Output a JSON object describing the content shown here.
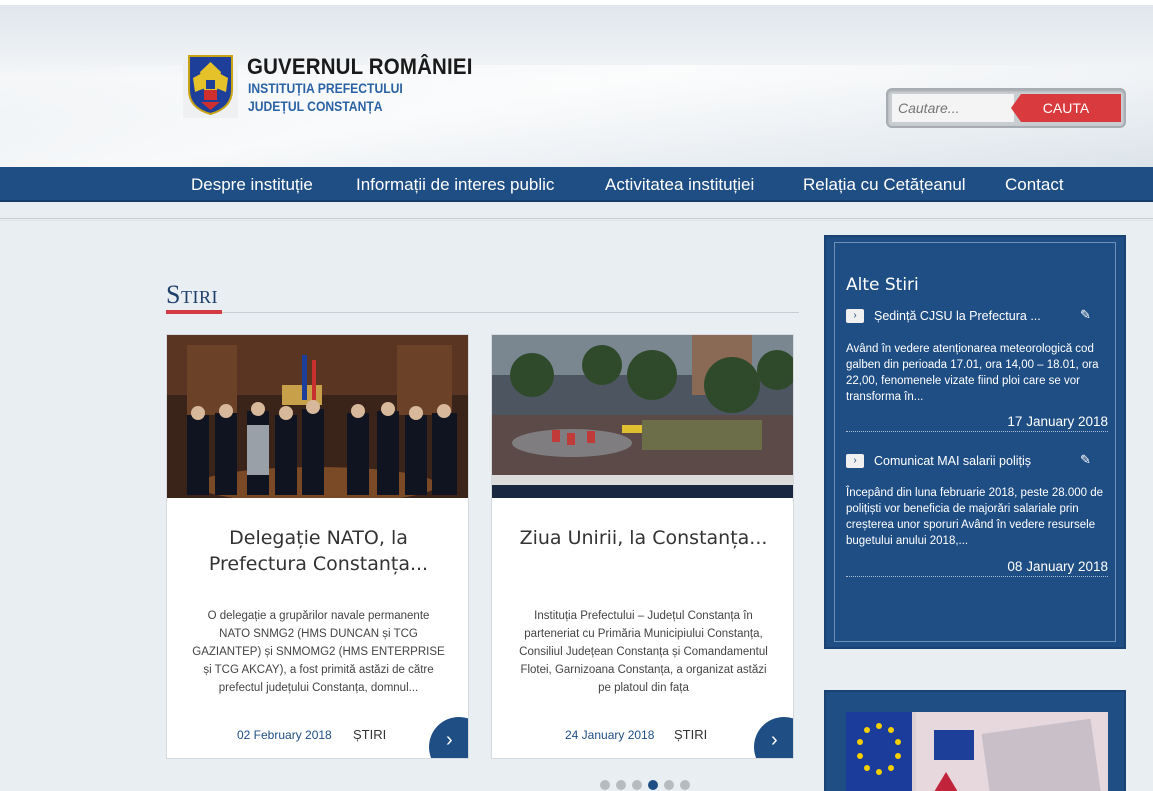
{
  "header": {
    "logo_title": "GUVERNUL ROMÂNIEI",
    "logo_sub1": "INSTITUȚIA PREFECTULUI",
    "logo_sub2": "JUDEȚUL CONSTANȚA",
    "search_placeholder": "Cautare...",
    "search_button": "CAUTA"
  },
  "nav": {
    "items": [
      {
        "label": "Despre instituție"
      },
      {
        "label": "Informații de interes public"
      },
      {
        "label": "Activitatea instituției"
      },
      {
        "label": "Relația cu Cetățeanul"
      },
      {
        "label": "Contact"
      }
    ]
  },
  "main": {
    "section_title": "Stiri",
    "cards": [
      {
        "title": "Delegație NATO, la Prefectura Constanța...",
        "text": "O delegație a grupărilor navale permanente NATO SNMG2 (HMS DUNCAN și TCG GAZIANTEP) și SNMOMG2 (HMS ENTERPRISE și TCG AKCAY), a fost primită astăzi de către prefectul județului Constanța, domnul...",
        "date": "02 February 2018",
        "category": "ȘTIRI"
      },
      {
        "title": "Ziua Unirii, la Constanța...",
        "text": "Instituția Prefectului – Județul Constanța în parteneriat cu Primăria Municipiului Constanța, Consiliul Județean Constanța și Comandamentul Flotei, Garnizoana Constanța, a organizat astăzi pe platoul din fața",
        "date": "24 January 2018",
        "category": "ȘTIRI"
      }
    ],
    "carousel_active_index": 3
  },
  "sidebar": {
    "title": "Alte Stiri",
    "items": [
      {
        "title": "Ședință CJSU la Prefectura ...",
        "text": "Având în vedere atenționarea meteorologică cod galben din perioada 17.01, ora 14,00 – 18.01, ora 22,00, fenomenele vizate fiind ploi care se vor transforma în...",
        "date": "17 January 2018"
      },
      {
        "title": "Comunicat MAI salarii polițiș",
        "text": "Începând din luna februarie 2018, peste 28.000 de polițiști vor beneficia de majorări salariale prin creșterea unor  sporuri Având în vedere resursele bugetului anului 2018,...",
        "date": "08 January 2018"
      }
    ]
  },
  "colors": {
    "primary_blue": "#1f4e84",
    "accent_red": "#d93a3e"
  }
}
